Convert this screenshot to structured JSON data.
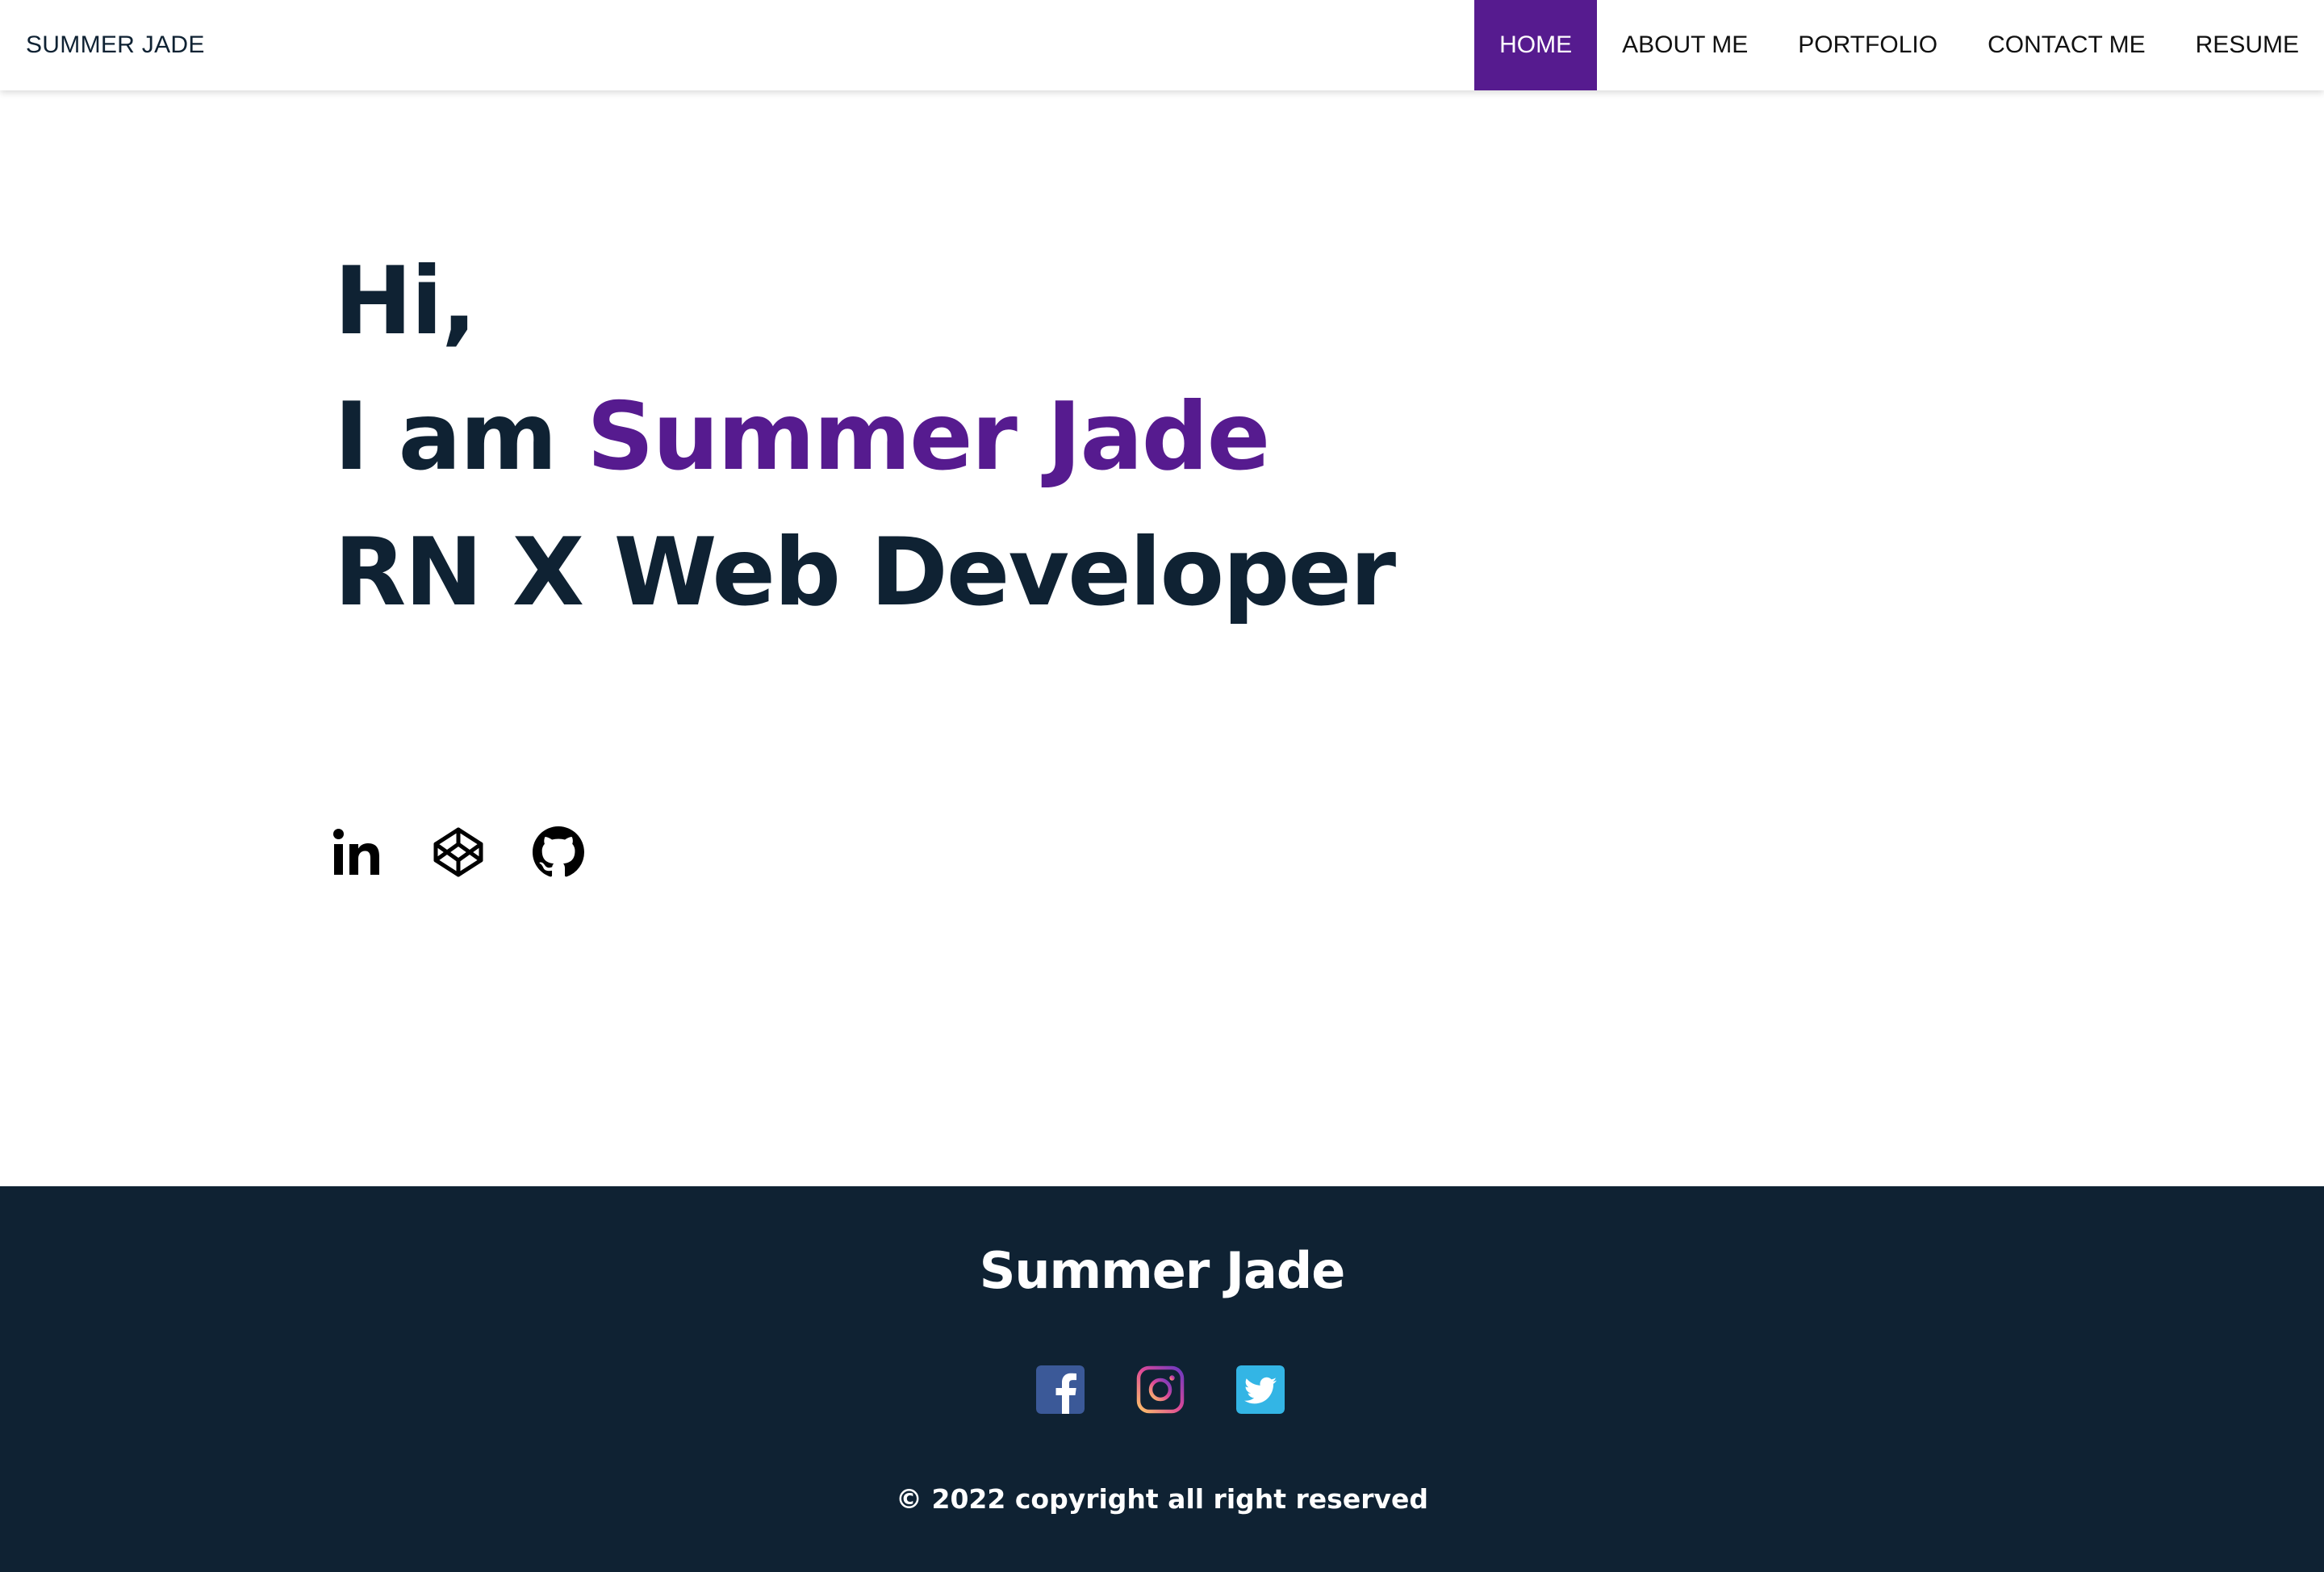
{
  "navbar": {
    "brand": "SUMMER JADE",
    "items": [
      {
        "label": "HOME",
        "active": true
      },
      {
        "label": "ABOUT ME",
        "active": false
      },
      {
        "label": "PORTFOLIO",
        "active": false
      },
      {
        "label": "CONTACT ME",
        "active": false
      },
      {
        "label": "RESUME",
        "active": false
      }
    ]
  },
  "hero": {
    "greeting": "Hi,",
    "intro_prefix": "I am ",
    "name": "Summer Jade",
    "role": "RN X Web Developer"
  },
  "social_links": [
    {
      "icon": "linkedin-icon"
    },
    {
      "icon": "codepen-icon"
    },
    {
      "icon": "github-icon"
    }
  ],
  "footer": {
    "title": "Summer Jade",
    "social": [
      {
        "icon": "facebook-icon"
      },
      {
        "icon": "instagram-icon"
      },
      {
        "icon": "twitter-icon"
      }
    ],
    "copyright": "© 2022 copyright all right reserved"
  },
  "colors": {
    "accent": "#561b8f",
    "dark": "#0f2233",
    "facebook": "#3b5998",
    "twitter": "#33b5e5",
    "instagram_gradient": [
      "#fdc468",
      "#df4996",
      "#6a38c2"
    ]
  }
}
